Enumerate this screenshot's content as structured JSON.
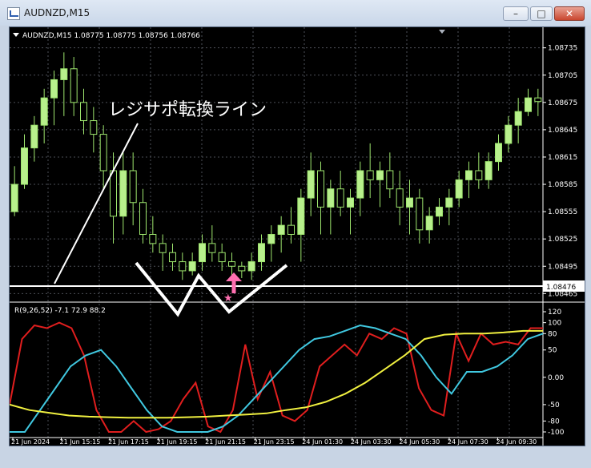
{
  "window": {
    "title": "AUDNZD,M15"
  },
  "window_controls": {
    "minimize": "–",
    "maximize": "□",
    "close": "✕"
  },
  "colors": {
    "background": "#000000",
    "grid": "#4d5058",
    "candle_up": "#b8f08c",
    "candle_down": "#000000",
    "candle_outline": "#9ee66e",
    "rsi": "#e01e1e",
    "stoch_k": "#40c8e0",
    "stoch_d": "#f0f040",
    "marker": "#ff6fb0",
    "annotation": "#ffffff"
  },
  "chart": {
    "info": "AUDNZD,M15  1.08775 1.08775 1.08756 1.08766",
    "price_axis": [
      "1.08735",
      "1.08705",
      "1.08675",
      "1.08645",
      "1.08615",
      "1.08585",
      "1.08555",
      "1.08525",
      "1.08495",
      "1.08465"
    ],
    "price_tag": "1.08476",
    "annotation": "レジサポ転換ライン",
    "indicator_label": "R(9,26,52) -7.1 72.9 88.2",
    "indicator_axis": [
      "120",
      "100",
      "80",
      "50",
      "0.00",
      "-50",
      "-80",
      "-100"
    ],
    "time_labels": [
      "21 Jun 2024",
      "21 Jun 15:15",
      "21 Jun 17:15",
      "21 Jun 19:15",
      "21 Jun 21:15",
      "21 Jun 23:15",
      "24 Jun 01:30",
      "24 Jun 03:30",
      "24 Jun 05:30",
      "24 Jun 07:30",
      "24 Jun 09:30"
    ]
  },
  "chart_data": {
    "type": "candlestick",
    "symbol": "AUDNZD",
    "timeframe": "M15",
    "ylim": [
      1.0846,
      1.0874
    ],
    "horizontal_line": 1.08476,
    "candles": [
      [
        1.08555,
        1.08605,
        1.0855,
        1.08585
      ],
      [
        1.08585,
        1.0864,
        1.0858,
        1.08625
      ],
      [
        1.08625,
        1.0866,
        1.0861,
        1.0865
      ],
      [
        1.0865,
        1.0869,
        1.0863,
        1.0868
      ],
      [
        1.0868,
        1.0871,
        1.0865,
        1.087
      ],
      [
        1.087,
        1.0873,
        1.0866,
        1.08712
      ],
      [
        1.08712,
        1.08725,
        1.0866,
        1.08675
      ],
      [
        1.08675,
        1.0869,
        1.0864,
        1.08655
      ],
      [
        1.08655,
        1.0867,
        1.0862,
        1.0864
      ],
      [
        1.0864,
        1.0865,
        1.0858,
        1.086
      ],
      [
        1.086,
        1.0862,
        1.0852,
        1.0855
      ],
      [
        1.0855,
        1.0862,
        1.0853,
        1.086
      ],
      [
        1.086,
        1.0862,
        1.0854,
        1.08565
      ],
      [
        1.08565,
        1.0858,
        1.0852,
        1.0853
      ],
      [
        1.0853,
        1.0855,
        1.0851,
        1.0852
      ],
      [
        1.0852,
        1.0853,
        1.0849,
        1.0851
      ],
      [
        1.0851,
        1.0852,
        1.0849,
        1.085
      ],
      [
        1.085,
        1.0851,
        1.0848,
        1.0849
      ],
      [
        1.0849,
        1.0851,
        1.08485,
        1.085
      ],
      [
        1.085,
        1.0853,
        1.0849,
        1.0852
      ],
      [
        1.0852,
        1.0854,
        1.085,
        1.0851
      ],
      [
        1.0851,
        1.0852,
        1.0849,
        1.085
      ],
      [
        1.085,
        1.0851,
        1.0848,
        1.08495
      ],
      [
        1.08495,
        1.085,
        1.08482,
        1.0849
      ],
      [
        1.0849,
        1.0851,
        1.0848,
        1.085
      ],
      [
        1.085,
        1.0853,
        1.0849,
        1.0852
      ],
      [
        1.0852,
        1.0854,
        1.085,
        1.0853
      ],
      [
        1.0853,
        1.0855,
        1.0851,
        1.0854
      ],
      [
        1.0854,
        1.0856,
        1.0852,
        1.0853
      ],
      [
        1.0853,
        1.0858,
        1.085,
        1.0857
      ],
      [
        1.0857,
        1.0862,
        1.0855,
        1.086
      ],
      [
        1.086,
        1.0861,
        1.0853,
        1.0856
      ],
      [
        1.0856,
        1.0859,
        1.0853,
        1.0858
      ],
      [
        1.0858,
        1.086,
        1.0855,
        1.0856
      ],
      [
        1.0856,
        1.0858,
        1.0853,
        1.0857
      ],
      [
        1.0857,
        1.0861,
        1.0855,
        1.086
      ],
      [
        1.086,
        1.0863,
        1.0857,
        1.0859
      ],
      [
        1.0859,
        1.0861,
        1.0856,
        1.086
      ],
      [
        1.086,
        1.0862,
        1.0857,
        1.0858
      ],
      [
        1.0858,
        1.086,
        1.0854,
        1.0856
      ],
      [
        1.0856,
        1.0859,
        1.0853,
        1.0857
      ],
      [
        1.0857,
        1.0858,
        1.0852,
        1.08535
      ],
      [
        1.08535,
        1.0856,
        1.0852,
        1.0855
      ],
      [
        1.0855,
        1.0857,
        1.0854,
        1.0856
      ],
      [
        1.0856,
        1.0858,
        1.0854,
        1.0857
      ],
      [
        1.0857,
        1.086,
        1.0856,
        1.0859
      ],
      [
        1.0859,
        1.0861,
        1.0857,
        1.086
      ],
      [
        1.086,
        1.0862,
        1.0858,
        1.0859
      ],
      [
        1.0859,
        1.0862,
        1.0858,
        1.0861
      ],
      [
        1.0861,
        1.0864,
        1.086,
        1.0863
      ],
      [
        1.0863,
        1.0866,
        1.0862,
        1.0865
      ],
      [
        1.0865,
        1.0868,
        1.0863,
        1.08665
      ],
      [
        1.08665,
        1.0869,
        1.0866,
        1.0868
      ],
      [
        1.0868,
        1.0869,
        1.0866,
        1.08676
      ]
    ],
    "indicator": {
      "name": "R(9,26,52)",
      "values": [
        -7.1,
        72.9,
        88.2
      ],
      "ylim": [
        -100,
        120
      ],
      "series": [
        {
          "values": [
            -50,
            70,
            95,
            90,
            100,
            90,
            40,
            -60,
            -100,
            -100,
            -80,
            -100,
            -95,
            -80,
            -40,
            -10,
            -90,
            -100,
            -60,
            60,
            -40,
            10,
            -70,
            -80,
            -60,
            20,
            40,
            60,
            40,
            80,
            70,
            90,
            80,
            -20,
            -60,
            -70,
            80,
            30,
            80,
            60,
            65,
            60,
            90,
            90
          ]
        },
        {
          "values": [
            -100,
            -100,
            -60,
            -20,
            20,
            40,
            50,
            20,
            -20,
            -60,
            -90,
            -100,
            -100,
            -100,
            -90,
            -70,
            -40,
            -10,
            20,
            50,
            70,
            75,
            85,
            95,
            90,
            80,
            70,
            40,
            0,
            -30,
            10,
            10,
            20,
            40,
            70,
            80
          ]
        },
        {
          "values": [
            -50,
            -60,
            -65,
            -70,
            -72,
            -73,
            -74,
            -74,
            -74,
            -73,
            -72,
            -70,
            -68,
            -66,
            -60,
            -55,
            -45,
            -30,
            -10,
            15,
            40,
            70,
            78,
            80,
            80,
            82,
            85,
            85
          ]
        }
      ]
    }
  }
}
